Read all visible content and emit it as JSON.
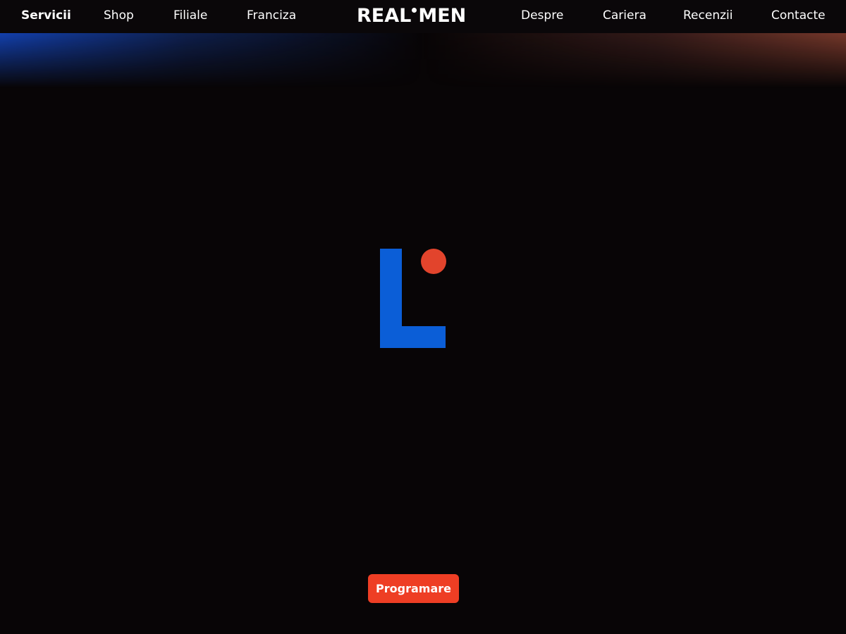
{
  "nav": {
    "left": [
      {
        "label": "Servicii",
        "active": true
      },
      {
        "label": "Shop"
      },
      {
        "label": "Filiale"
      },
      {
        "label": "Franciza"
      }
    ],
    "right": [
      {
        "label": "Despre"
      },
      {
        "label": "Cariera"
      },
      {
        "label": "Recenzii"
      },
      {
        "label": "Contacte"
      }
    ],
    "brand": {
      "part1": "REAL",
      "part2": "MEN"
    }
  },
  "loader": {
    "icon": "realmen-l-dot-logo-icon",
    "colors": {
      "bar": "#0b5ed7",
      "dot": "#e2442c"
    }
  },
  "cta": {
    "label": "Programare",
    "color": "#ee3e24"
  },
  "colors": {
    "background": "#080506",
    "navbar": "#0a0709",
    "text": "#ffffff"
  }
}
